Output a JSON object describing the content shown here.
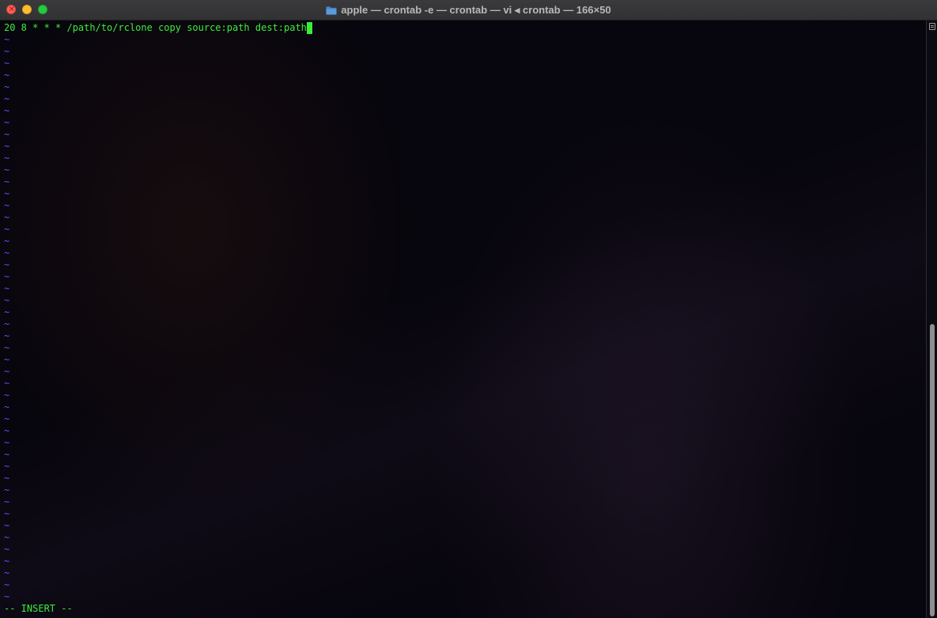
{
  "window": {
    "title": "apple — crontab -e — crontab — vi ◂ crontab — 166×50",
    "close_glyph": "×"
  },
  "editor": {
    "command_line": "20 8 * * * /path/to/rclone copy source:path dest:path",
    "empty_line_marker": "~",
    "empty_line_count": 48,
    "mode_status": "-- INSERT --"
  },
  "scrollbar": {
    "position_fraction": 0.5
  },
  "colors": {
    "text": "#39ee3a",
    "tilde": "#6c4cf0",
    "background": "#07050d"
  },
  "icons": {
    "title_icon": "folder-icon",
    "scroll_button": "scroll-lines-icon"
  }
}
